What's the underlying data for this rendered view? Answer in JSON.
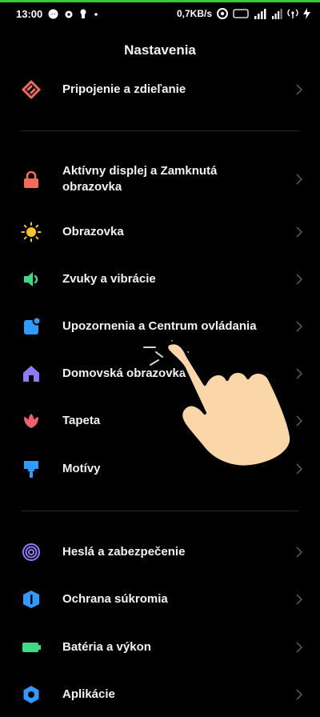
{
  "status": {
    "time": "13:00",
    "speed": "0,7KB/s"
  },
  "header": {
    "title": "Nastavenia"
  },
  "items": [
    {
      "label": "Pripojenie a zdieľanie",
      "icon": "connection-share-icon",
      "color": "#f26b5b"
    },
    {
      "label": "Aktívny displej a Zamknutá obrazovka",
      "icon": "lock-icon",
      "color": "#f26b5b"
    },
    {
      "label": "Obrazovka",
      "icon": "sun-icon",
      "color": "#f5c431"
    },
    {
      "label": "Zvuky a vibrácie",
      "icon": "speaker-icon",
      "color": "#3ddc84"
    },
    {
      "label": "Upozornenia a Centrum ovládania",
      "icon": "notification-icon",
      "color": "#2f9bff"
    },
    {
      "label": "Domovská obrazovka",
      "icon": "home-icon",
      "color": "#8c7cf7"
    },
    {
      "label": "Tapeta",
      "icon": "flower-icon",
      "color": "#f0606e"
    },
    {
      "label": "Motívy",
      "icon": "brush-icon",
      "color": "#2f9bff"
    },
    {
      "label": "Heslá a zabezpečenie",
      "icon": "fingerprint-icon",
      "color": "#8c7cf7"
    },
    {
      "label": "Ochrana súkromia",
      "icon": "privacy-shield-icon",
      "color": "#2f9bff"
    },
    {
      "label": "Batéria a výkon",
      "icon": "battery-icon",
      "color": "#3ddc84"
    },
    {
      "label": "Aplikácie",
      "icon": "gear-icon",
      "color": "#2f9bff"
    }
  ],
  "accent_colors": {
    "status_line": "#3fc43a",
    "hand_fill": "#fbd6a8"
  }
}
